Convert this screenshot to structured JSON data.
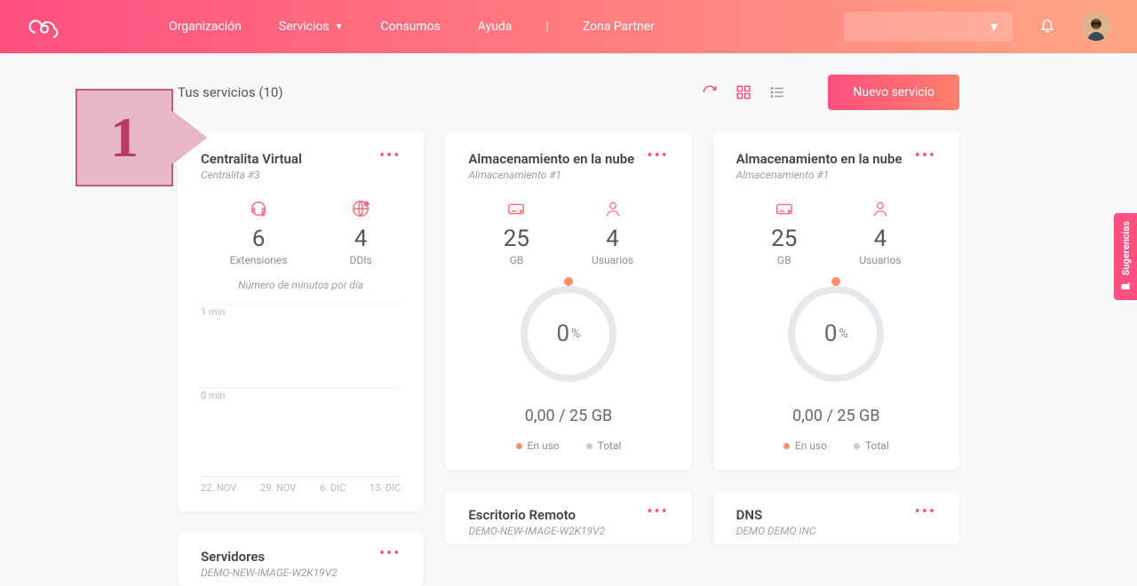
{
  "nav": {
    "org": "Organización",
    "services": "Servicios",
    "consumption": "Consumos",
    "help": "Ayuda",
    "partner": "Zona Partner"
  },
  "page": {
    "title": "Tus servicios (10)",
    "new_service": "Nuevo servicio"
  },
  "annotation": {
    "number": "1"
  },
  "sidetab": "Sugerencias",
  "cards": {
    "centralita": {
      "title": "Centralita Virtual",
      "subtitle": "Centralita #3",
      "ext_num": "6",
      "ext_label": "Extensiones",
      "ddi_num": "4",
      "ddi_label": "DDIs",
      "minutes_caption": "Número de minutos por día",
      "y1": "1 min",
      "y0": "0 min",
      "x": [
        "22. NOV",
        "29. NOV",
        "6. DIC",
        "13. DIC"
      ]
    },
    "storage1": {
      "title": "Almacenamiento en la nube",
      "subtitle": "Almacenamiento #1",
      "gb_num": "25",
      "gb_label": "GB",
      "users_num": "4",
      "users_label": "Usuarios",
      "gauge_pct": "0",
      "usage": "0,00 / 25 GB",
      "legend_use": "En uso",
      "legend_total": "Total"
    },
    "storage2": {
      "title": "Almacenamiento en la nube",
      "subtitle": "Almacenamiento #1",
      "gb_num": "25",
      "gb_label": "GB",
      "users_num": "4",
      "users_label": "Usuarios",
      "gauge_pct": "0",
      "usage": "0,00 / 25 GB",
      "legend_use": "En uso",
      "legend_total": "Total"
    },
    "servers": {
      "title": "Servidores",
      "subtitle": "DEMO-NEW-IMAGE-W2K19V2"
    },
    "remote": {
      "title": "Escritorio Remoto",
      "subtitle": "DEMO-NEW-IMAGE-W2K19V2"
    },
    "dns": {
      "title": "DNS",
      "subtitle": "DEMO DEMO INC"
    }
  }
}
